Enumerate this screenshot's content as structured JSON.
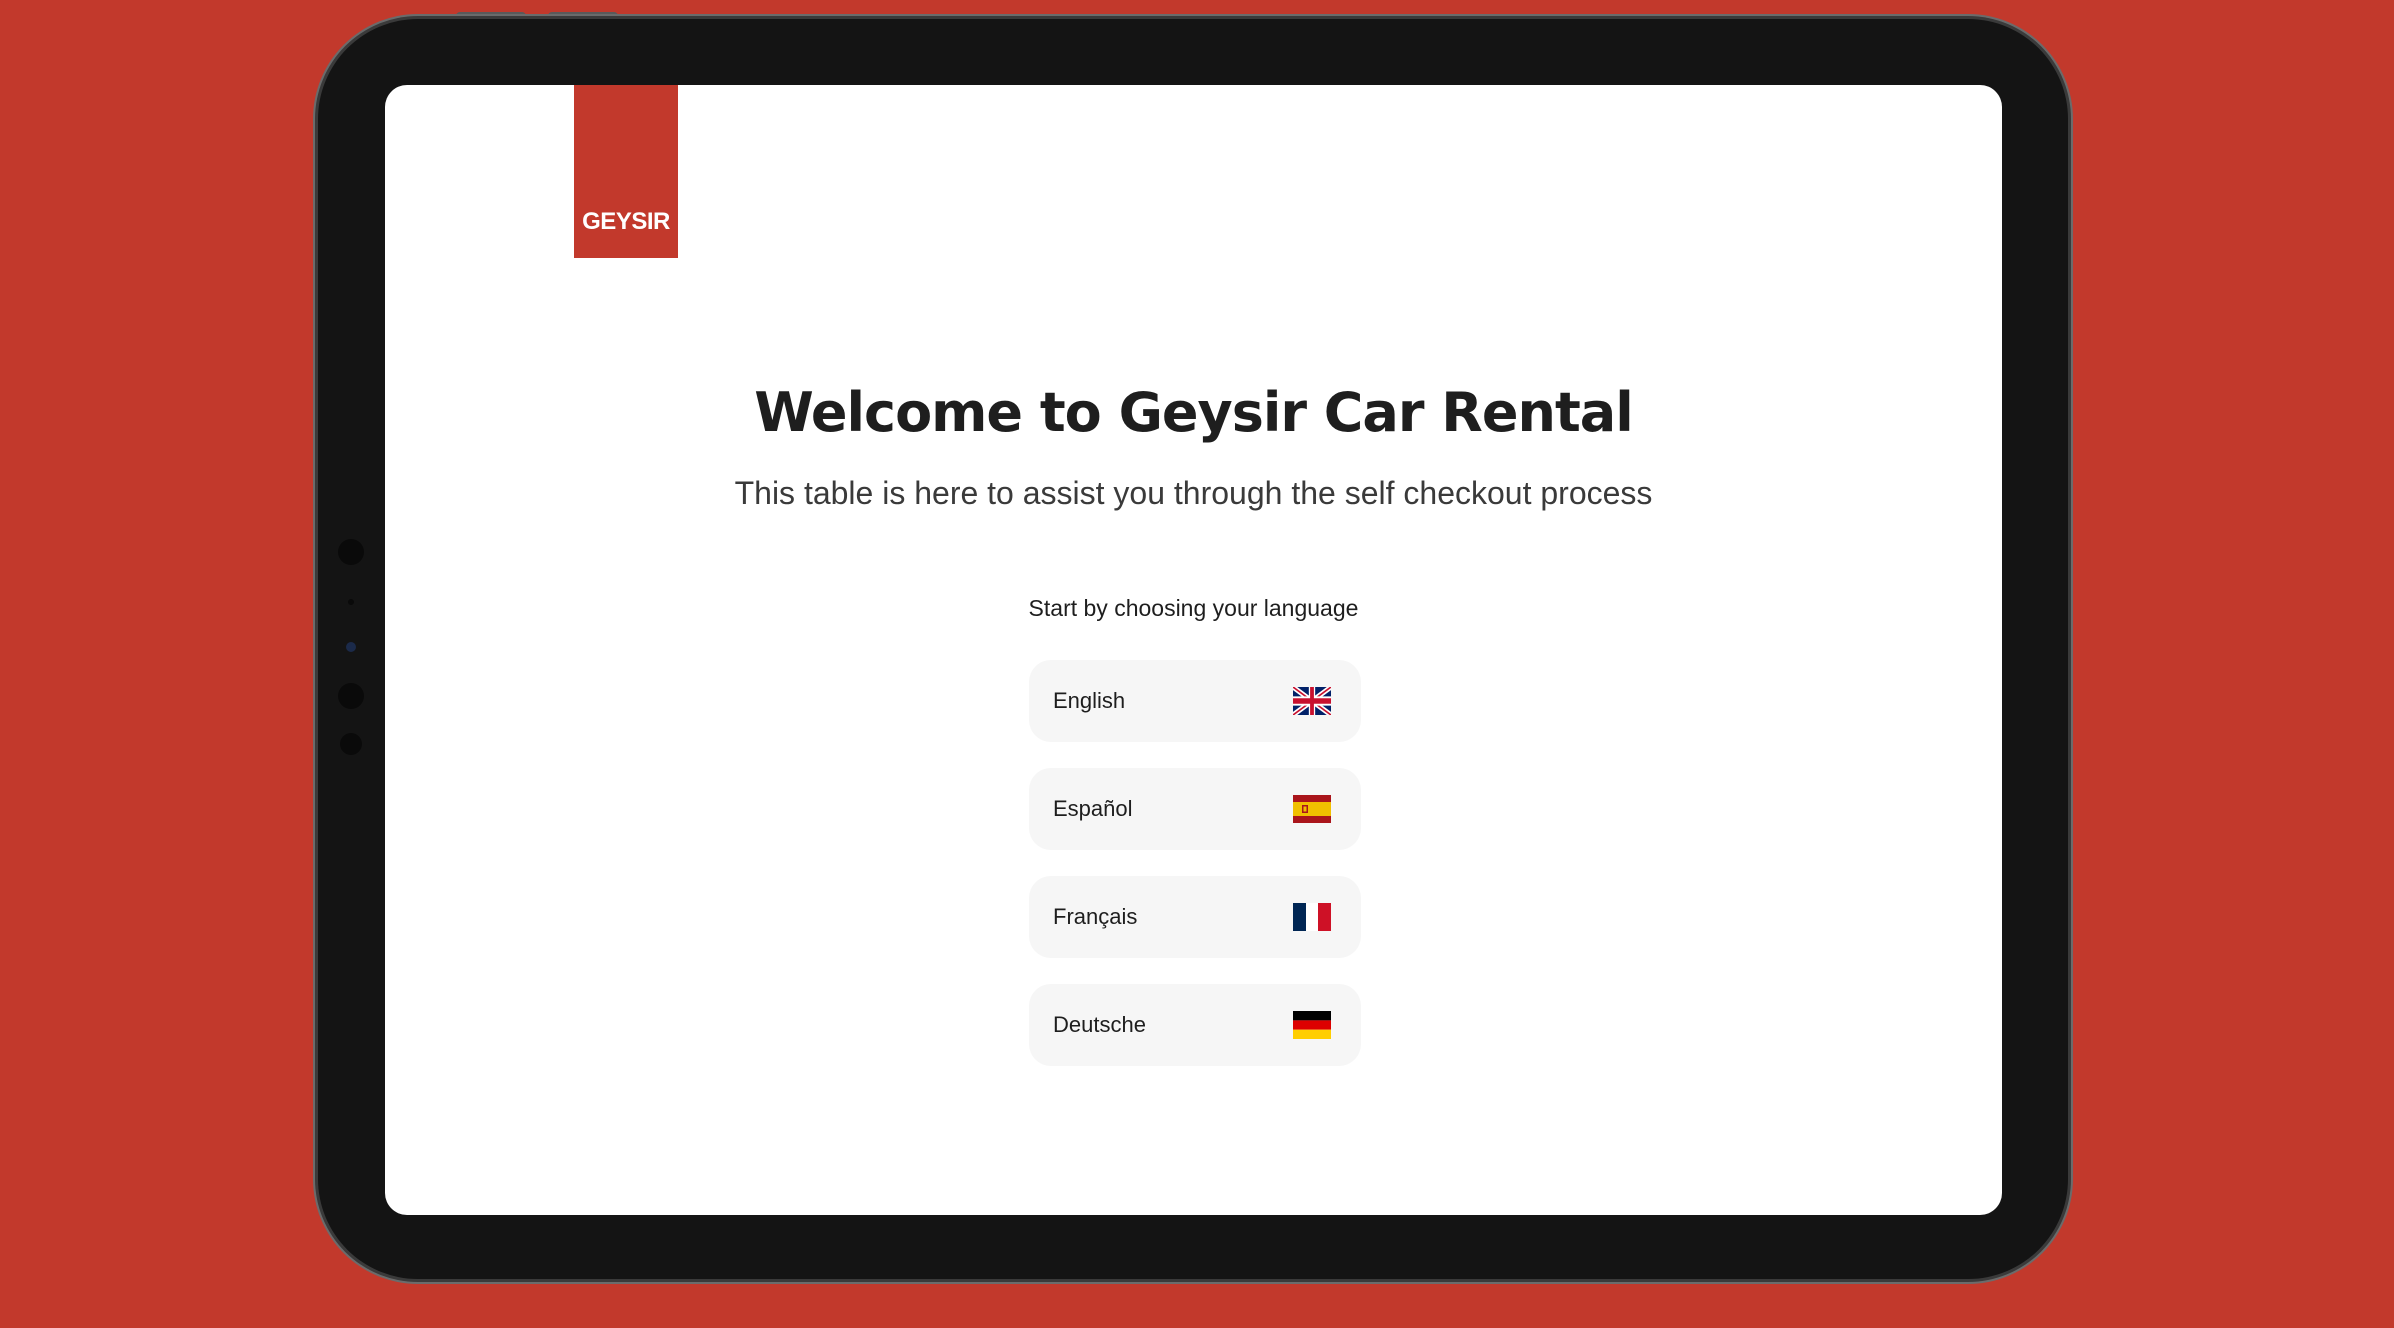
{
  "brand": {
    "logo_text": "GEYSIR",
    "accent_color": "#c2392c"
  },
  "welcome": {
    "title": "Welcome to Geysir Car Rental",
    "subtitle": "This table is here to assist you through the self checkout process",
    "prompt": "Start by choosing your language"
  },
  "languages": [
    {
      "label": "English",
      "flag": "uk-flag-icon"
    },
    {
      "label": "Español",
      "flag": "spain-flag-icon"
    },
    {
      "label": "Français",
      "flag": "france-flag-icon"
    },
    {
      "label": "Deutsche",
      "flag": "germany-flag-icon"
    }
  ]
}
